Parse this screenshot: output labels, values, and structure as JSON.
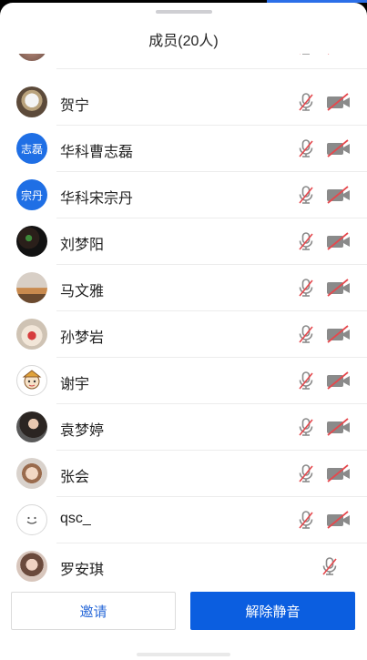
{
  "panel": {
    "title": "成员(20人)"
  },
  "members": [
    {
      "name": "",
      "avatar": "partial-photo",
      "mic": "muted",
      "cam": "off"
    },
    {
      "name": "贺宁",
      "avatar": "photo-astronaut",
      "mic": "muted",
      "cam": "off"
    },
    {
      "name": "华科曹志磊",
      "avatar": "text",
      "avatar_text": "志磊",
      "mic": "muted",
      "cam": "off"
    },
    {
      "name": "华科宋宗丹",
      "avatar": "text",
      "avatar_text": "宗丹",
      "mic": "muted",
      "cam": "off"
    },
    {
      "name": "刘梦阳",
      "avatar": "photo-dark",
      "mic": "muted",
      "cam": "off"
    },
    {
      "name": "马文雅",
      "avatar": "photo-sunset",
      "mic": "muted",
      "cam": "off"
    },
    {
      "name": "孙梦岩",
      "avatar": "photo-cake",
      "mic": "muted",
      "cam": "off"
    },
    {
      "name": "谢宇",
      "avatar": "cartoon",
      "mic": "muted",
      "cam": "off"
    },
    {
      "name": "袁梦婷",
      "avatar": "photo-person",
      "mic": "muted",
      "cam": "off"
    },
    {
      "name": "张会",
      "avatar": "photo-child",
      "mic": "muted",
      "cam": "off"
    },
    {
      "name": "qsc_",
      "avatar": "smiley",
      "mic": "muted",
      "cam": "off"
    },
    {
      "name": "罗安琪",
      "avatar": "photo-girl",
      "mic": "muted",
      "cam": "none"
    }
  ],
  "buttons": {
    "invite_label": "邀请",
    "unmute_label": "解除静音"
  },
  "colors": {
    "accent": "#0b5ee0",
    "muted_red": "#e5484d",
    "icon_gray": "#8a8a8a",
    "avatar_blue": "#1f6fe5"
  },
  "icons": {
    "mic": "mic-muted-icon",
    "camera": "camera-off-icon"
  }
}
